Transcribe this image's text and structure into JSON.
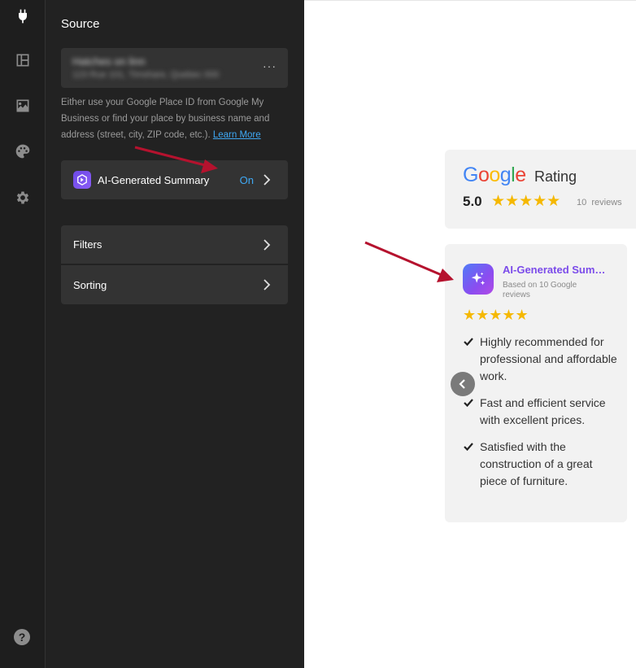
{
  "rail": {
    "icons": [
      "plug-icon",
      "layout-icon",
      "image-icon",
      "palette-icon",
      "gear-icon"
    ],
    "help_label": "?"
  },
  "panel": {
    "title": "Source",
    "source": {
      "name": "Hatches on linn",
      "address": "123 Rue 101, Timshare, Quebec 000"
    },
    "more_label": "···",
    "help_text": "Either use your Google Place ID from Google My Business or find your place by business name and address (street, city, ZIP code, etc.).",
    "learn_more": "Learn More",
    "ai_row": {
      "label": "AI-Generated Summary",
      "status": "On"
    },
    "filters_label": "Filters",
    "sorting_label": "Sorting"
  },
  "preview": {
    "rating_card": {
      "brand": "Google",
      "title": "Rating",
      "score": "5.0",
      "stars": "★★★★★",
      "reviews_count": "10",
      "reviews_label": "reviews"
    },
    "ai_card": {
      "title": "AI-Generated Summary",
      "subtitle": "Based on 10 Google reviews",
      "stars": "★★★★★",
      "bullets": [
        "Highly recommended for professional and affordable work.",
        "Fast and efficient service with excellent prices.",
        "Satisfied with the construction of a great piece of furniture."
      ]
    }
  },
  "colors": {
    "accent_blue": "#3fa9f5",
    "ai_purple": "#7b4bea",
    "star_yellow": "#f5b800",
    "arrow_red": "#b5122e",
    "google_blue": "#4285F4",
    "google_red": "#EA4335",
    "google_yellow": "#FBBC05",
    "google_green": "#34A853"
  }
}
